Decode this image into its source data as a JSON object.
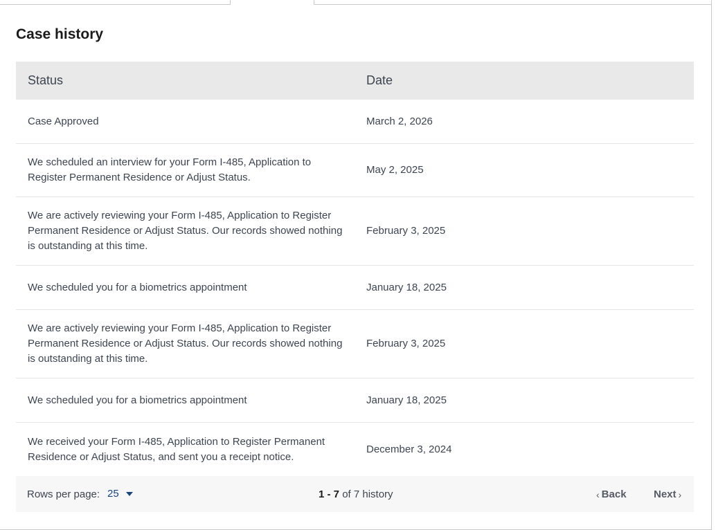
{
  "case_history": {
    "title": "Case history",
    "columns": {
      "status": "Status",
      "date": "Date"
    },
    "rows": [
      {
        "status": "Case Approved",
        "date": "March 2, 2026"
      },
      {
        "status": "We scheduled an interview for your Form I-485, Application to Register Permanent Residence or Adjust Status.",
        "date": "May 2, 2025"
      },
      {
        "status": "We are actively reviewing your Form I-485, Application to Register Permanent Residence or Adjust Status. Our records showed nothing is outstanding at this time.",
        "date": "February 3, 2025"
      },
      {
        "status": "We scheduled you for a biometrics appointment",
        "date": "January 18, 2025"
      },
      {
        "status": "We are actively reviewing your Form I-485, Application to Register Permanent Residence or Adjust Status. Our records showed nothing is outstanding at this time.",
        "date": "February 3, 2025"
      },
      {
        "status": "We scheduled you for a biometrics appointment",
        "date": "January 18, 2025"
      },
      {
        "status": "We received your Form I-485, Application to Register Permanent Residence or Adjust Status, and sent you a receipt notice.",
        "date": "December 3, 2024"
      }
    ]
  },
  "pagination": {
    "rows_per_page_label": "Rows per page:",
    "rows_per_page_value": "25",
    "range": "1 - 7",
    "of_text": "of 7 history",
    "back_label": "Back",
    "next_label": "Next"
  },
  "icons": {
    "caret": "caret-down-icon",
    "back": "chevron-left-icon",
    "next": "chevron-right-icon"
  },
  "colors": {
    "header_bg": "#e9e9e9",
    "link": "#1a4480",
    "text": "#3d4551",
    "footer_bg": "#f7f7f7"
  }
}
